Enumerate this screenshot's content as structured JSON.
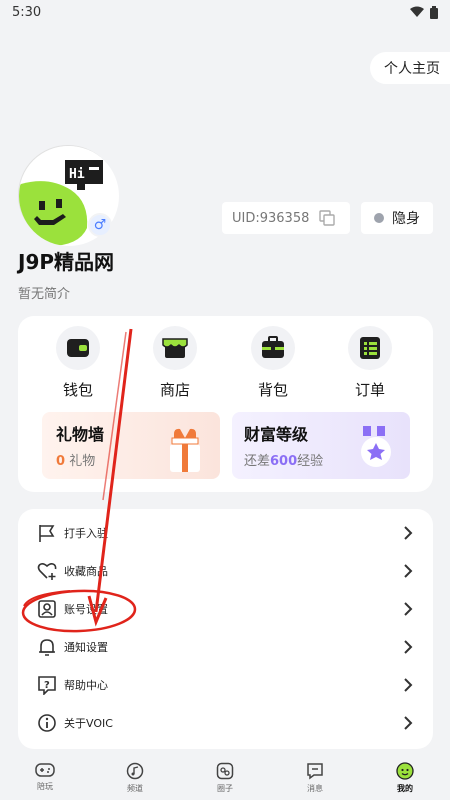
{
  "status_bar": {
    "time": "5:30"
  },
  "header": {
    "profile_home": "个人主页"
  },
  "profile": {
    "uid": "UID:936358",
    "stealth": "隐身",
    "username": "J9P精品网",
    "bio": "暂无简介",
    "gender_symbol": "♂"
  },
  "quick_actions": [
    {
      "label": "钱包",
      "icon": "wallet-icon"
    },
    {
      "label": "商店",
      "icon": "shop-icon"
    },
    {
      "label": "背包",
      "icon": "backpack-icon"
    },
    {
      "label": "订单",
      "icon": "order-icon"
    }
  ],
  "gift_wall": {
    "title": "礼物墙",
    "count": "0",
    "unit": "礼物"
  },
  "wealth_level": {
    "title": "财富等级",
    "prefix": "还差",
    "value": "600",
    "suffix": "经验"
  },
  "menu": [
    {
      "label": "打手入驻",
      "icon": "flag-icon"
    },
    {
      "label": "收藏商品",
      "icon": "heart-plus-icon"
    },
    {
      "label": "账号设置",
      "icon": "account-icon"
    },
    {
      "label": "通知设置",
      "icon": "bell-icon"
    },
    {
      "label": "帮助中心",
      "icon": "help-icon"
    },
    {
      "label": "关于VOIC",
      "icon": "info-icon"
    }
  ],
  "tabs": [
    {
      "label": "陪玩",
      "icon": "gamepad-icon"
    },
    {
      "label": "频道",
      "icon": "music-icon"
    },
    {
      "label": "圈子",
      "icon": "circle-icon"
    },
    {
      "label": "消息",
      "icon": "message-icon"
    },
    {
      "label": "我的",
      "icon": "smile-icon",
      "active": true
    }
  ],
  "colors": {
    "accent_orange": "#f07a3a",
    "accent_purple": "#8b6ff5",
    "annotation_red": "#e0241b",
    "avatar_green": "#9be13c"
  }
}
